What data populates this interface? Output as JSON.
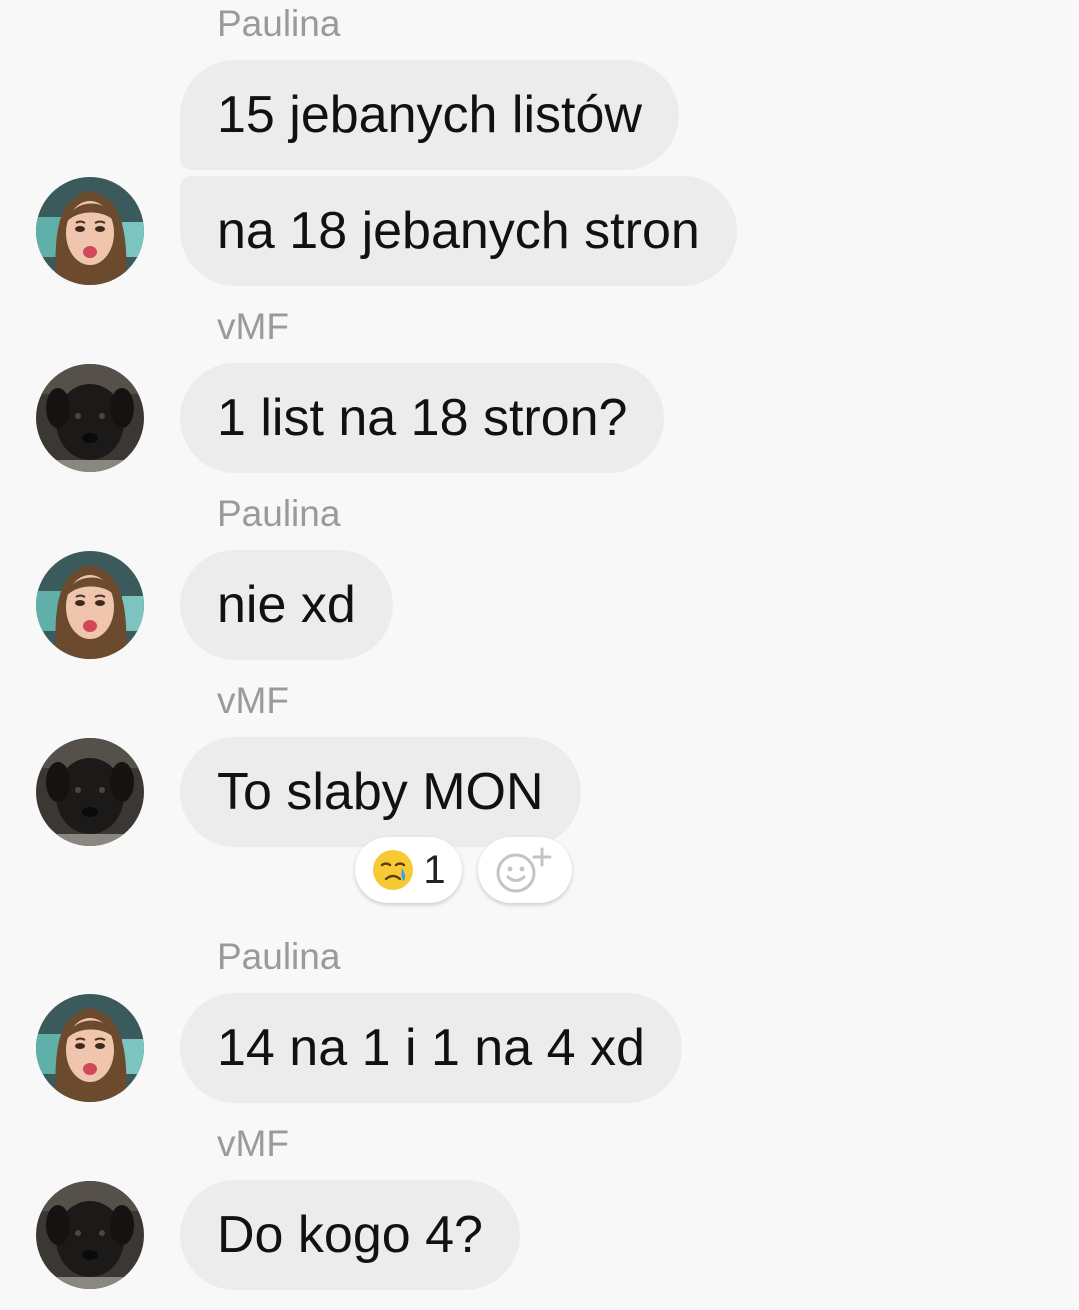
{
  "participants": {
    "paulina": "Paulina",
    "vmf": "vMF"
  },
  "messages": [
    {
      "sender": "Paulina",
      "text": "15 jebanych listów"
    },
    {
      "sender": "Paulina",
      "text": "na 18 jebanych stron"
    },
    {
      "sender": "vMF",
      "text": "1 list na 18 stron?"
    },
    {
      "sender": "Paulina",
      "text": "nie xd"
    },
    {
      "sender": "vMF",
      "text": "To slaby MON"
    },
    {
      "sender": "Paulina",
      "text": "14 na 1 i 1 na 4 xd"
    },
    {
      "sender": "vMF",
      "text": "Do kogo 4?"
    }
  ],
  "reaction": {
    "emoji_icon": "crying-face-emoji",
    "count": "1",
    "add_icon": "add-reaction-icon"
  },
  "colors": {
    "background": "#f8f8f8",
    "bubble": "#ececec",
    "sender_name": "#9a9a9a",
    "text": "#111111"
  }
}
